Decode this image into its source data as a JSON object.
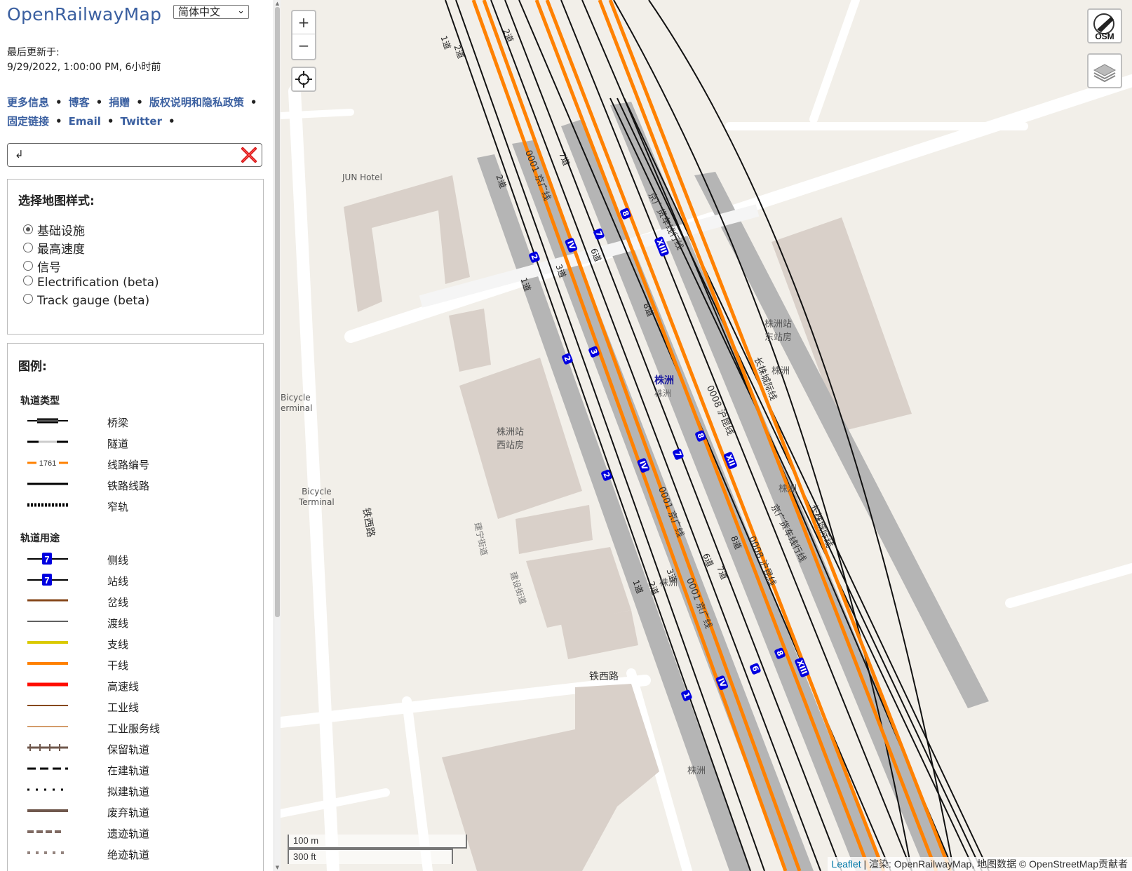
{
  "app": {
    "title": "OpenRailwayMap",
    "language": "简体中文"
  },
  "update": {
    "label": "最后更新于:",
    "value": "9/29/2022, 1:00:00 PM, 6小时前"
  },
  "links": [
    "更多信息",
    "博客",
    "捐赠",
    "版权说明和隐私政策",
    "固定链接",
    "Email",
    "Twitter"
  ],
  "search": {
    "value": "↲"
  },
  "style_box": {
    "heading": "选择地图样式:",
    "options": [
      "基础设施",
      "最高速度",
      "信号",
      "Electrification (beta)",
      "Track gauge (beta)"
    ],
    "selected": "基础设施"
  },
  "legend": {
    "heading": "图例:",
    "track_type": {
      "heading": "轨道类型",
      "items": [
        {
          "label": "桥梁",
          "icon": "bridge"
        },
        {
          "label": "隧道",
          "icon": "tunnel"
        },
        {
          "label": "线路编号",
          "icon": "route-ref",
          "sample": "1761"
        },
        {
          "label": "铁路线路",
          "icon": "rail"
        },
        {
          "label": "窄轨",
          "icon": "narrow-gauge"
        }
      ]
    },
    "track_usage": {
      "heading": "轨道用途",
      "items": [
        {
          "label": "侧线",
          "icon": "siding",
          "color": "#0000e0",
          "sample": "7"
        },
        {
          "label": "站线",
          "icon": "station-track",
          "color": "#0000e0",
          "sample": "7"
        },
        {
          "label": "岔线",
          "icon": "spur",
          "color": "#87491d"
        },
        {
          "label": "渡线",
          "icon": "crossover",
          "color": "#000000"
        },
        {
          "label": "支线",
          "icon": "branch",
          "color": "#daca00"
        },
        {
          "label": "干线",
          "icon": "main",
          "color": "#ff8100"
        },
        {
          "label": "高速线",
          "icon": "highspeed",
          "color": "#ff0c00"
        },
        {
          "label": "工业线",
          "icon": "industrial",
          "color": "#87491d"
        },
        {
          "label": "工业服务线",
          "icon": "industrial-service",
          "color": "#d39b6a"
        },
        {
          "label": "保留轨道",
          "icon": "preserved",
          "color": "#70584d"
        },
        {
          "label": "在建轨道",
          "icon": "construction",
          "color": "#000000"
        },
        {
          "label": "拟建轨道",
          "icon": "proposed",
          "color": "#000000"
        },
        {
          "label": "废弃轨道",
          "icon": "disused",
          "color": "#70584d"
        },
        {
          "label": "遗迹轨道",
          "icon": "abandoned",
          "color": "#7f6a62"
        },
        {
          "label": "绝迹轨道",
          "icon": "razed",
          "color": "#94847f"
        }
      ]
    }
  },
  "map": {
    "zoom_in": "+",
    "zoom_out": "−",
    "scale_metric": "100 m",
    "scale_imperial": "300 ft",
    "attribution_leaflet": "Leaflet",
    "attribution_text": " | 渲染: OpenRailwayMap, 地图数据 © OpenStreetMap贡献者",
    "labels": {
      "hotel": "JUN Hotel",
      "bicycle_1": "Bicycle",
      "bicycle_1b": "erminal",
      "bicycle_2": "Bicycle",
      "bicycle_2b": "Terminal",
      "west_hall_1": "株洲站",
      "west_hall_2": "西站房",
      "east_1": "株洲站",
      "east_2": "东站房",
      "station": "株洲",
      "station_sub": "株洲",
      "tiexi_road": "铁西路",
      "tiexi_road_2": "铁西路",
      "jianshe_street": "建设街道",
      "jianning_street": "建宁街道",
      "zhuzhou_a": "株洲",
      "zhuzhou_b": "株洲",
      "zhuzhou_c": "株洲",
      "zhuzhou_d": "株洲",
      "jingguang": "0001 京广线",
      "huhkun": "0008 沪昆线",
      "changzhu": "长株城际线",
      "jinghu_freight": "京广货车线行线",
      "track_1": "1道",
      "track_2": "2道",
      "track_3": "3道",
      "track_6": "6道",
      "track_7": "7道",
      "track_8": "8道",
      "osm_logo": "OSM"
    },
    "track_markers": [
      "2",
      "1",
      "IV",
      "3",
      "7",
      "6",
      "8",
      "XIII",
      "XII"
    ]
  }
}
